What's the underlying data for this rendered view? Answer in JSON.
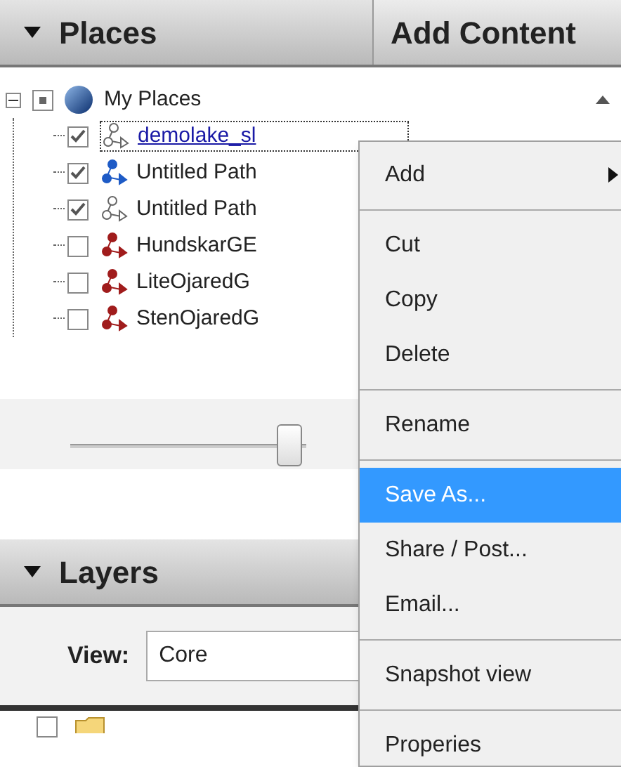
{
  "places_panel": {
    "title": "Places",
    "expanded": true
  },
  "add_content_button": {
    "label": "Add Content"
  },
  "tree": {
    "label": "My Places",
    "expanded": true,
    "partial": true,
    "children": [
      {
        "label": "demolake_sl",
        "checked": true,
        "selected": true,
        "kind": "outline",
        "color": "#666666"
      },
      {
        "label": "Untitled Path",
        "checked": true,
        "selected": false,
        "kind": "solid",
        "color": "#1e5bc6"
      },
      {
        "label": "Untitled Path",
        "checked": true,
        "selected": false,
        "kind": "outline",
        "color": "#666666"
      },
      {
        "label": "HundskarGE",
        "checked": false,
        "selected": false,
        "kind": "solid",
        "color": "#a01c1c"
      },
      {
        "label": "LiteOjaredG",
        "checked": false,
        "selected": false,
        "kind": "solid",
        "color": "#a01c1c"
      },
      {
        "label": "StenOjaredG",
        "checked": false,
        "selected": false,
        "kind": "solid",
        "color": "#a01c1c"
      }
    ]
  },
  "slider": {
    "level": 0.93
  },
  "layers_panel": {
    "title": "Layers",
    "expanded": true
  },
  "view": {
    "label": "View:",
    "value": "Core"
  },
  "layers_tree": [
    {
      "checked": false
    }
  ],
  "context_menu": [
    {
      "kind": "item",
      "label": "Add",
      "has_submenu": true,
      "selected": false
    },
    {
      "kind": "separator"
    },
    {
      "kind": "item",
      "label": "Cut",
      "has_submenu": false,
      "selected": false
    },
    {
      "kind": "item",
      "label": "Copy",
      "has_submenu": false,
      "selected": false
    },
    {
      "kind": "item",
      "label": "Delete",
      "has_submenu": false,
      "selected": false
    },
    {
      "kind": "separator"
    },
    {
      "kind": "item",
      "label": "Rename",
      "has_submenu": false,
      "selected": false
    },
    {
      "kind": "separator"
    },
    {
      "kind": "item",
      "label": "Save As...",
      "has_submenu": false,
      "selected": true
    },
    {
      "kind": "item",
      "label": "Share / Post...",
      "has_submenu": false,
      "selected": false
    },
    {
      "kind": "item",
      "label": "Email...",
      "has_submenu": false,
      "selected": false
    },
    {
      "kind": "separator"
    },
    {
      "kind": "item",
      "label": "Snapshot view",
      "has_submenu": false,
      "selected": false
    },
    {
      "kind": "separator"
    },
    {
      "kind": "item",
      "label": "Properies",
      "has_submenu": false,
      "selected": false
    }
  ]
}
